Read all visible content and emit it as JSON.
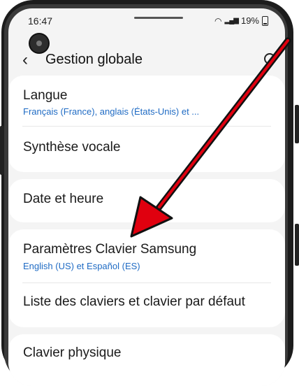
{
  "status": {
    "time": "16:47",
    "battery": "19%"
  },
  "header": {
    "title": "Gestion globale"
  },
  "items": [
    {
      "title": "Langue",
      "subtitle": "Français (France), anglais (États-Unis) et ..."
    },
    {
      "title": "Synthèse vocale"
    },
    {
      "title": "Date et heure"
    },
    {
      "title": "Paramètres Clavier Samsung",
      "subtitle": "English (US) et Español (ES)"
    },
    {
      "title": "Liste des claviers et clavier par défaut"
    },
    {
      "title": "Clavier physique"
    }
  ],
  "colors": {
    "link": "#1f6bc4",
    "arrow": "#e0000f"
  }
}
